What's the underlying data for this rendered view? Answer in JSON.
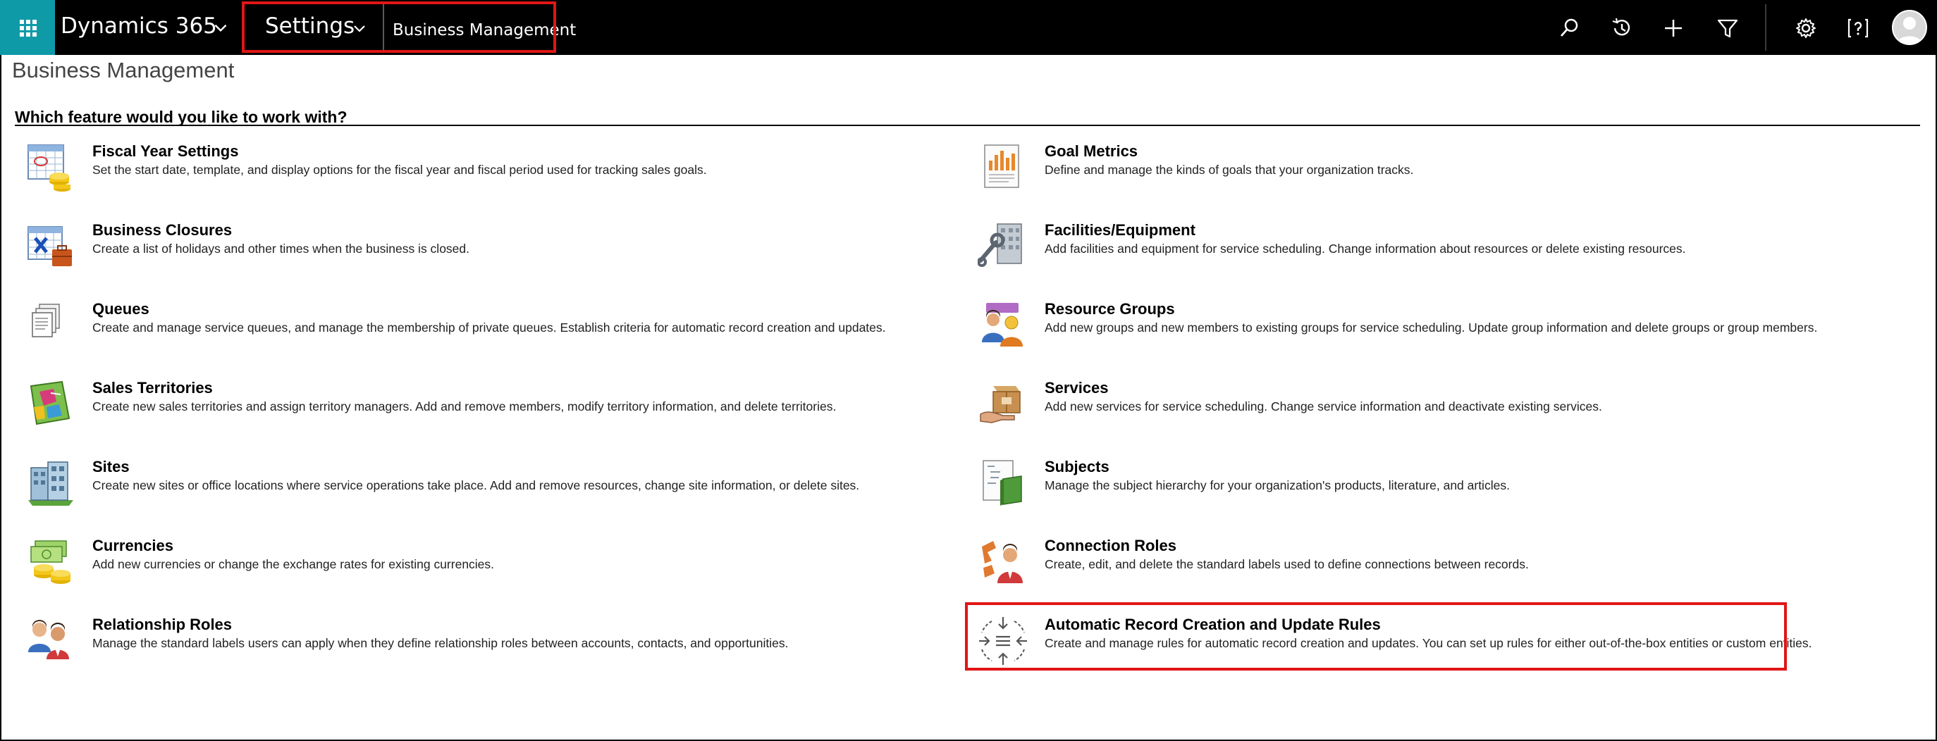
{
  "topbar": {
    "app_title": "Dynamics 365",
    "area": "Settings",
    "breadcrumb": "Business Management",
    "icons": [
      "waffle-icon",
      "search-icon",
      "history-icon",
      "plus-icon",
      "filter-icon",
      "gear-icon",
      "help-icon",
      "avatar-icon"
    ]
  },
  "page": {
    "title": "Business Management",
    "question": "Which feature would you like to work with?"
  },
  "features_left": [
    {
      "title": "Fiscal Year Settings",
      "desc": "Set the start date, template, and display options for the fiscal year and fiscal period used for tracking sales goals.",
      "icon": "fiscal-calendar-icon"
    },
    {
      "title": "Business Closures",
      "desc": "Create a list of holidays and other times when the business is closed.",
      "icon": "business-closure-icon"
    },
    {
      "title": "Queues",
      "desc": "Create and manage service queues, and manage the membership of private queues. Establish criteria for automatic record creation and updates.",
      "icon": "queue-icon"
    },
    {
      "title": "Sales Territories",
      "desc": "Create new sales territories and assign territory managers. Add and remove members, modify territory information, and delete territories.",
      "icon": "territory-map-icon"
    },
    {
      "title": "Sites",
      "desc": "Create new sites or office locations where service operations take place. Add and remove resources, change site information, or delete sites.",
      "icon": "site-building-icon"
    },
    {
      "title": "Currencies",
      "desc": "Add new currencies or change the exchange rates for existing currencies.",
      "icon": "currency-icon"
    },
    {
      "title": "Relationship Roles",
      "desc": "Manage the standard labels users can apply when they define relationship roles between accounts, contacts, and opportunities.",
      "icon": "relationship-roles-icon"
    }
  ],
  "features_right": [
    {
      "title": "Goal Metrics",
      "desc": "Define and manage the kinds of goals that your organization tracks.",
      "icon": "goal-metrics-icon"
    },
    {
      "title": "Facilities/Equipment",
      "desc": "Add facilities and equipment for service scheduling. Change information about resources or delete existing resources.",
      "icon": "facilities-icon"
    },
    {
      "title": "Resource Groups",
      "desc": "Add new groups and new members to existing groups for service scheduling. Update group information and delete groups or group members.",
      "icon": "resource-groups-icon"
    },
    {
      "title": "Services",
      "desc": "Add new services for service scheduling. Change service information and deactivate existing services.",
      "icon": "services-icon"
    },
    {
      "title": "Subjects",
      "desc": "Manage the subject hierarchy for your organization's products, literature, and articles.",
      "icon": "subjects-icon"
    },
    {
      "title": "Connection Roles",
      "desc": "Create, edit, and delete the standard labels used to define connections between records.",
      "icon": "connection-roles-icon"
    },
    {
      "title": "Automatic Record Creation and Update Rules",
      "desc": "Create and manage rules for automatic record creation and updates. You can set up rules for either out-of-the-box entities or custom entities.",
      "icon": "auto-record-rules-icon"
    }
  ],
  "colors": {
    "topbar_bg": "#000000",
    "waffle_bg": "#0f9aa8",
    "highlight": "#e01515"
  }
}
